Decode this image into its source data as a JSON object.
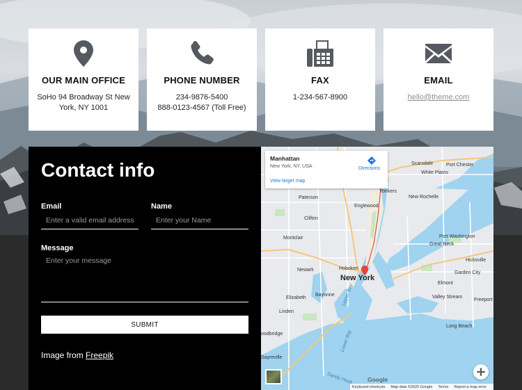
{
  "cards": [
    {
      "icon": "map-pin-icon",
      "title": "OUR MAIN OFFICE",
      "lines": [
        "SoHo 94 Broadway St New",
        "York, NY 1001"
      ]
    },
    {
      "icon": "phone-icon",
      "title": "PHONE NUMBER",
      "lines": [
        "234-9876-5400",
        "888-0123-4567 (Toll Free)"
      ]
    },
    {
      "icon": "fax-icon",
      "title": "FAX",
      "lines": [
        "1-234-567-8900"
      ]
    },
    {
      "icon": "envelope-icon",
      "title": "EMAIL",
      "lines": [
        "hello@theme.com"
      ]
    }
  ],
  "contact": {
    "title": "Contact info",
    "email_label": "Email",
    "email_placeholder": "Enter a valid email address",
    "name_label": "Name",
    "name_placeholder": "Enter your Name",
    "message_label": "Message",
    "message_placeholder": "Enter your message",
    "submit_label": "SUBMIT",
    "credit_prefix": "Image from",
    "credit_link": "Freepik"
  },
  "map": {
    "place_name": "Manhattan",
    "place_address": "New York, NY, USA",
    "directions_label": "Directions",
    "larger_map_label": "View larger map",
    "city_label": "New York",
    "labels": {
      "yonkers": "Yonkers",
      "paterson": "Paterson",
      "englewood": "Englewood",
      "clifton": "Clifton",
      "montclair": "Montclair",
      "newark": "Newark",
      "hoboken": "Hoboken",
      "elizabeth": "Elizabeth",
      "bayonne": "Bayonne",
      "linden": "Linden",
      "scarsdale": "Scarsdale",
      "port_chester": "Port Chester",
      "white_plains": "White Plains",
      "new_rochelle": "New Rochelle",
      "great_neck": "Great Neck",
      "port_washington": "Port Washington",
      "hicksville": "Hicksville",
      "garden_city": "Garden City",
      "elmont": "Elmont",
      "valley_stream": "Valley Stream",
      "freeport": "Freeport",
      "long_beach": "Long Beach",
      "woodbridge": "oodbridge",
      "sayreville": "Sayreville",
      "lower_bay": "Lower Bay",
      "upper_bay": "Upper Bay",
      "sandy_hook": "Sandy Hook",
      "google": "Google"
    },
    "footer": [
      "Keyboard shortcuts",
      "Map data ©2025 Google",
      "Terms",
      "Report a map error"
    ]
  },
  "colors": {
    "card_bg": "#ffffff",
    "panel_bg": "#000000",
    "icon_gray": "#555a60",
    "map_water": "#9fd3ef",
    "map_land": "#e8eaed"
  }
}
